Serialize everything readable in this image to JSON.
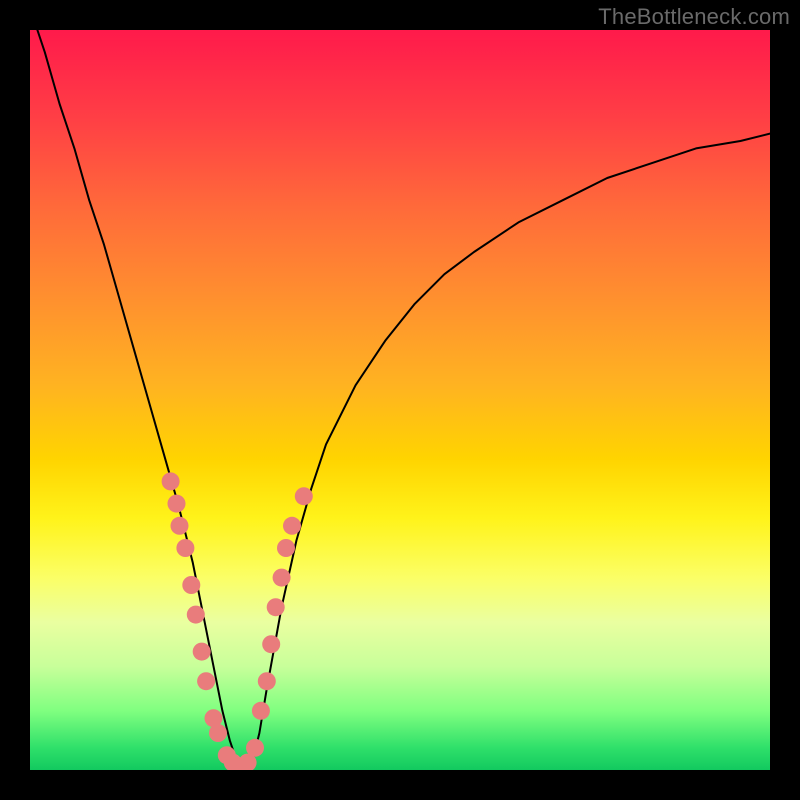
{
  "watermark": "TheBottleneck.com",
  "chart_data": {
    "type": "line",
    "title": "",
    "xlabel": "",
    "ylabel": "",
    "xlim": [
      0,
      100
    ],
    "ylim": [
      0,
      100
    ],
    "series": [
      {
        "name": "bottleneck-curve",
        "x": [
          0,
          2,
          4,
          6,
          8,
          10,
          12,
          14,
          16,
          18,
          20,
          22,
          24,
          25,
          26,
          27,
          28,
          29,
          30,
          31,
          32,
          34,
          36,
          38,
          40,
          44,
          48,
          52,
          56,
          60,
          66,
          72,
          78,
          84,
          90,
          96,
          100
        ],
        "y": [
          103,
          97,
          90,
          84,
          77,
          71,
          64,
          57,
          50,
          43,
          36,
          28,
          18,
          13,
          8,
          4,
          1,
          0,
          1,
          5,
          11,
          22,
          31,
          38,
          44,
          52,
          58,
          63,
          67,
          70,
          74,
          77,
          80,
          82,
          84,
          85,
          86
        ]
      }
    ],
    "markers": [
      {
        "x": 19.0,
        "y": 39
      },
      {
        "x": 19.8,
        "y": 36
      },
      {
        "x": 20.2,
        "y": 33
      },
      {
        "x": 21.0,
        "y": 30
      },
      {
        "x": 21.8,
        "y": 25
      },
      {
        "x": 22.4,
        "y": 21
      },
      {
        "x": 23.2,
        "y": 16
      },
      {
        "x": 23.8,
        "y": 12
      },
      {
        "x": 24.8,
        "y": 7
      },
      {
        "x": 25.4,
        "y": 5
      },
      {
        "x": 26.6,
        "y": 2
      },
      {
        "x": 27.4,
        "y": 1
      },
      {
        "x": 28.4,
        "y": 0.5
      },
      {
        "x": 29.4,
        "y": 1
      },
      {
        "x": 30.4,
        "y": 3
      },
      {
        "x": 31.2,
        "y": 8
      },
      {
        "x": 32.0,
        "y": 12
      },
      {
        "x": 32.6,
        "y": 17
      },
      {
        "x": 33.2,
        "y": 22
      },
      {
        "x": 34.0,
        "y": 26
      },
      {
        "x": 34.6,
        "y": 30
      },
      {
        "x": 35.4,
        "y": 33
      },
      {
        "x": 37.0,
        "y": 37
      }
    ],
    "marker_color": "#e97c7c",
    "marker_radius_px": 9
  }
}
